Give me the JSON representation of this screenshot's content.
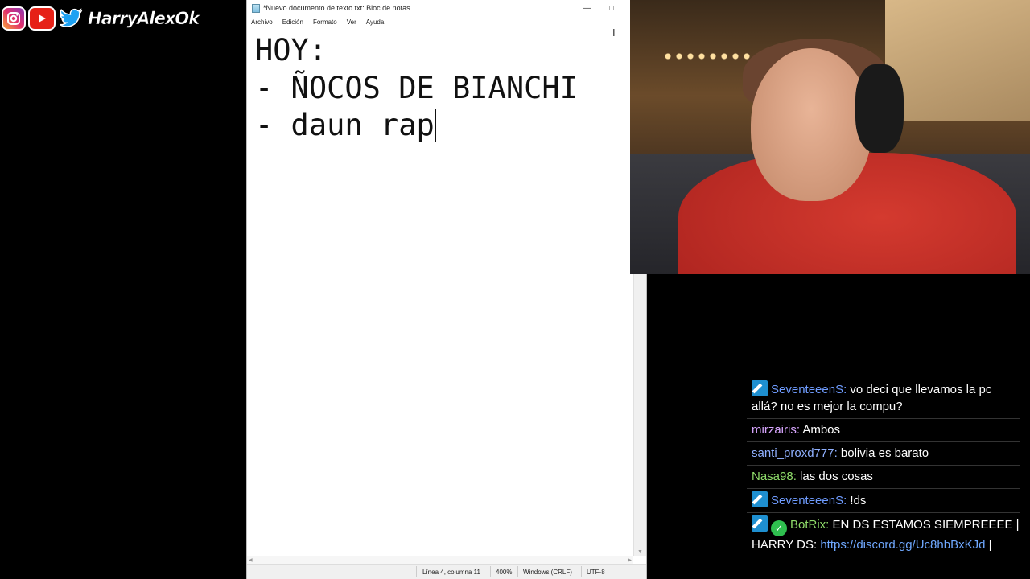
{
  "social": {
    "handle": "HarryAlexOk",
    "icons": [
      "instagram-icon",
      "youtube-icon",
      "twitter-icon"
    ]
  },
  "notepad": {
    "title": "*Nuevo documento de texto.txt: Bloc de notas",
    "menu": [
      "Archivo",
      "Edición",
      "Formato",
      "Ver",
      "Ayuda"
    ],
    "lines": [
      "HOY:",
      "",
      "- ÑOCOS DE BIANCHI",
      "- daun rap"
    ],
    "status": {
      "position": "Línea 4, columna 11",
      "zoom": "400%",
      "line_ending": "Windows (CRLF)",
      "encoding": "UTF-8"
    }
  },
  "chat": {
    "messages": [
      {
        "user": "SeventeeenS:",
        "color": "#6f9cff",
        "badges": [
          "mod"
        ],
        "text": " vo deci que llevamos la pc allá? no es mejor la compu?"
      },
      {
        "user": "mirzairis:",
        "color": "#d8a6ff",
        "badges": [],
        "text": " Ambos"
      },
      {
        "user": "santi_proxd777:",
        "color": "#8fb0ff",
        "badges": [],
        "text": " bolivia es barato"
      },
      {
        "user": "Nasa98:",
        "color": "#8fdc6a",
        "badges": [],
        "text": " las dos cosas"
      },
      {
        "user": "SeventeeenS:",
        "color": "#6f9cff",
        "badges": [
          "mod"
        ],
        "text": " !ds"
      },
      {
        "user": "BotRix:",
        "color": "#8fdc6a",
        "badges": [
          "mod",
          "verified"
        ],
        "text": " EN DS ESTAMOS SIEMPREEEE | HARRY DS: ",
        "link": "https://discord.gg/Uc8hbBxKJd",
        "suffix": " |"
      }
    ]
  }
}
